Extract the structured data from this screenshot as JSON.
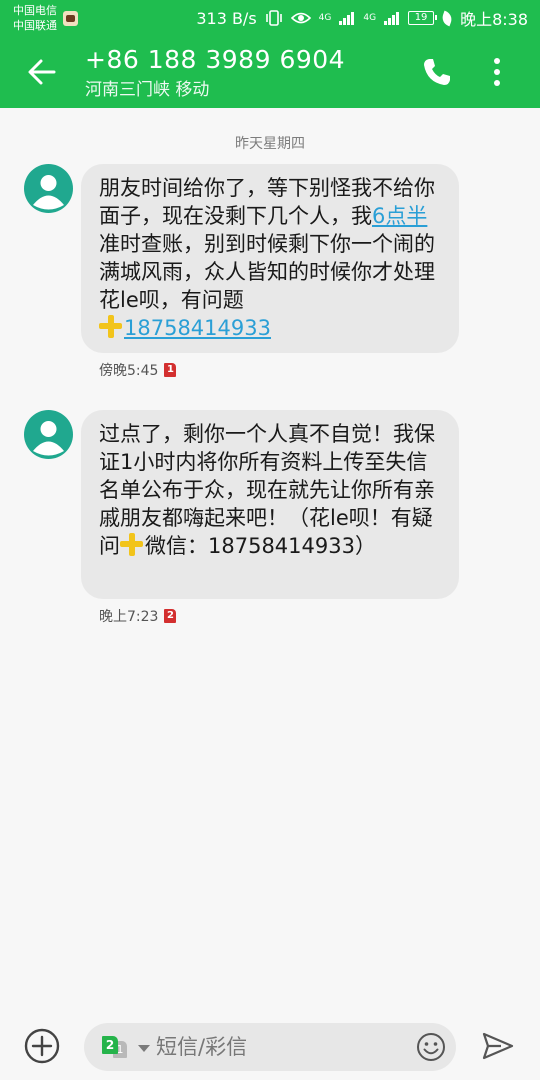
{
  "status_bar": {
    "carrier1": "中国电信",
    "carrier2": "中国联通",
    "speed": "313 B/s",
    "net1": "4G",
    "net2": "4G",
    "battery": "19",
    "time": "晚上8:38"
  },
  "header": {
    "title": "+86 188 3989 6904",
    "subtitle": "河南三门峡 移动",
    "back_icon": "arrow-left-icon",
    "call_icon": "phone-icon",
    "more_icon": "more-vertical-icon"
  },
  "conversation": {
    "date_separator": "昨天星期四",
    "messages": [
      {
        "text_a": "朋友时间给你了，等下别怪我不给你面子，现在没剩下几个人，我",
        "link1": "6点半",
        "text_b": "准时查账，别到时候剩下你一个闹的满城风雨，众人皆知的时候你才处理花le呗，有问题",
        "link2": "18758414933",
        "time": "傍晚5:45",
        "sim": "1"
      },
      {
        "text_a": "过点了，剩你一个人真不自觉！我保证1小时内将你所有资料上传至失信名单公布于众，现在就先让你所有亲戚朋友都嗨起来吧！（花le呗！有疑问",
        "text_b": "微信：18758414933）",
        "time": "晚上7:23",
        "sim": "2"
      }
    ]
  },
  "composer": {
    "sim_front": "2",
    "sim_back": "1",
    "placeholder": "短信/彩信",
    "add_icon": "add-circle-icon",
    "emoji_icon": "emoji-icon",
    "send_icon": "send-icon"
  },
  "colors": {
    "accent": "#1fbd4f",
    "bubble": "#e8e8e8",
    "link": "#2a9fd6",
    "sim_badge": "#d32f2f"
  }
}
